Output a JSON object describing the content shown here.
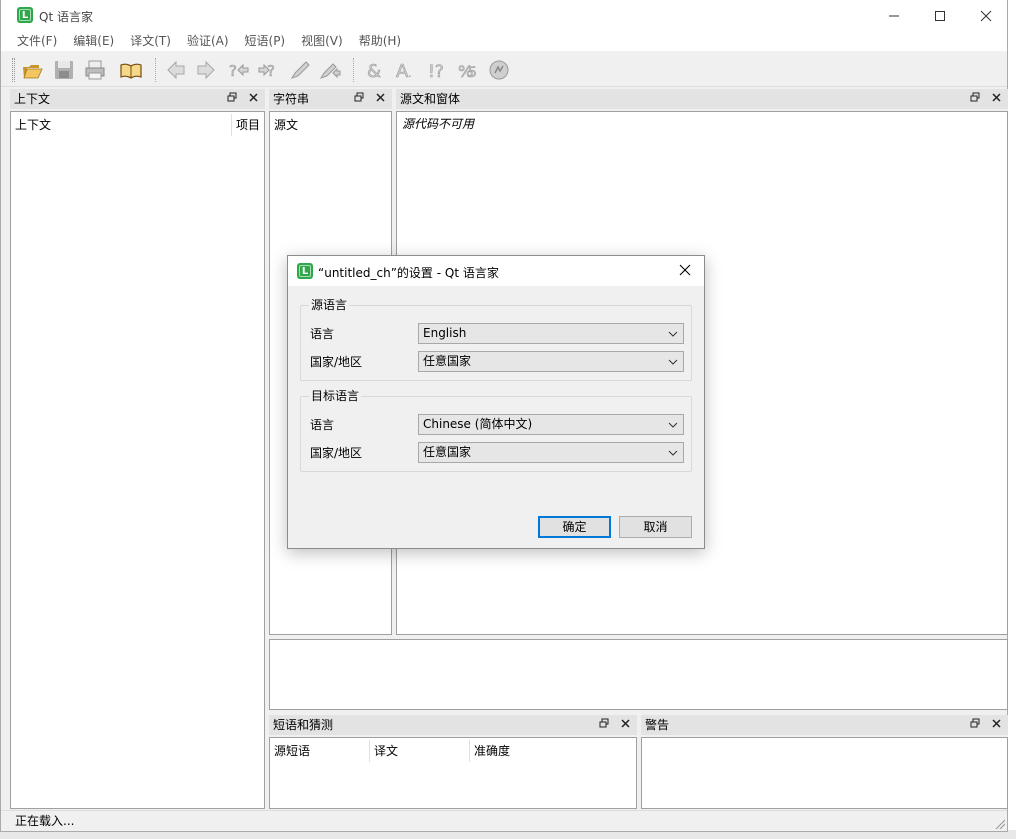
{
  "window": {
    "title": "Qt 语言家",
    "icon_letter": "L",
    "minimize": "—",
    "maximize": "☐",
    "close": "✕"
  },
  "menu": [
    "文件(F)",
    "编辑(E)",
    "译文(T)",
    "验证(A)",
    "短语(P)",
    "视图(V)",
    "帮助(H)"
  ],
  "toolbar": {
    "icons": [
      "open-icon",
      "save-icon",
      "print-icon",
      "phrasebook-icon",
      "prev-icon",
      "next-icon",
      "prev-unfinished-icon",
      "next-unfinished-icon",
      "done-icon",
      "done-next-icon",
      "accelerator-check-icon",
      "ending-punctuation-check-icon",
      "phrase-match-check-icon",
      "placeholder-check-icon",
      "surrounding-whitespace-check-icon"
    ]
  },
  "docks": {
    "context": {
      "title": "上下文",
      "columns": [
        "上下文",
        "项目"
      ]
    },
    "strings": {
      "title": "字符串",
      "columns": [
        "源文"
      ]
    },
    "sources": {
      "title": "源文和窗体",
      "message": "源代码不可用"
    },
    "phrases": {
      "title": "短语和猜测",
      "columns": [
        "源短语",
        "译文",
        "准确度"
      ]
    },
    "warnings": {
      "title": "警告"
    },
    "float_glyph": "🗗",
    "close_glyph": "✕"
  },
  "status": {
    "text": "正在载入..."
  },
  "dialog": {
    "title": "“untitled_ch”的设置 - Qt 语言家",
    "close": "✕",
    "source_group": {
      "title": "源语言",
      "language_label": "语言",
      "language_value": "English",
      "country_label": "国家/地区",
      "country_value": "任意国家"
    },
    "target_group": {
      "title": "目标语言",
      "language_label": "语言",
      "language_value": "Chinese (简体中文)",
      "country_label": "国家/地区",
      "country_value": "任意国家"
    },
    "ok_label": "确定",
    "cancel_label": "取消"
  }
}
